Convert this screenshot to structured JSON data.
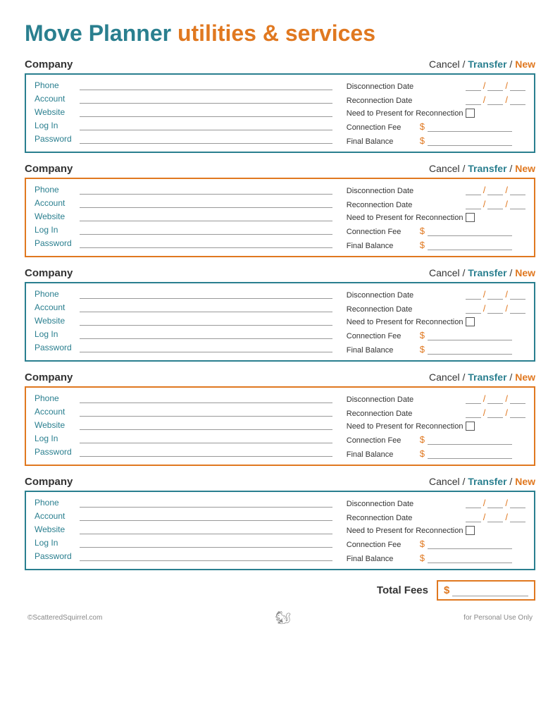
{
  "page": {
    "title_blue": "Move Planner",
    "title_orange": "utilities & services"
  },
  "sections": [
    {
      "id": 1,
      "border": "teal",
      "company_label": "Company",
      "cancel_label": "Cancel",
      "slash1": "/",
      "transfer_label": "Transfer",
      "slash2": "/",
      "new_label": "New",
      "left_fields": [
        {
          "label": "Phone"
        },
        {
          "label": "Account"
        },
        {
          "label": "Website"
        },
        {
          "label": "Log In"
        },
        {
          "label": "Password"
        }
      ],
      "right_fields": [
        {
          "type": "date",
          "label": "Disconnection Date"
        },
        {
          "type": "date",
          "label": "Reconnection Date"
        },
        {
          "type": "checkbox",
          "label": "Need to Present for Reconnection"
        },
        {
          "type": "fee",
          "label": "Connection Fee"
        },
        {
          "type": "fee",
          "label": "Final Balance"
        }
      ]
    },
    {
      "id": 2,
      "border": "orange",
      "company_label": "Company",
      "cancel_label": "Cancel",
      "slash1": "/",
      "transfer_label": "Transfer",
      "slash2": "/",
      "new_label": "New",
      "left_fields": [
        {
          "label": "Phone"
        },
        {
          "label": "Account"
        },
        {
          "label": "Website"
        },
        {
          "label": "Log In"
        },
        {
          "label": "Password"
        }
      ],
      "right_fields": [
        {
          "type": "date",
          "label": "Disconnection Date"
        },
        {
          "type": "date",
          "label": "Reconnection Date"
        },
        {
          "type": "checkbox",
          "label": "Need to Present for Reconnection"
        },
        {
          "type": "fee",
          "label": "Connection Fee"
        },
        {
          "type": "fee",
          "label": "Final Balance"
        }
      ]
    },
    {
      "id": 3,
      "border": "teal",
      "company_label": "Company",
      "cancel_label": "Cancel",
      "slash1": "/",
      "transfer_label": "Transfer",
      "slash2": "/",
      "new_label": "New",
      "left_fields": [
        {
          "label": "Phone"
        },
        {
          "label": "Account"
        },
        {
          "label": "Website"
        },
        {
          "label": "Log In"
        },
        {
          "label": "Password"
        }
      ],
      "right_fields": [
        {
          "type": "date",
          "label": "Disconnection Date"
        },
        {
          "type": "date",
          "label": "Reconnection Date"
        },
        {
          "type": "checkbox",
          "label": "Need to Present for Reconnection"
        },
        {
          "type": "fee",
          "label": "Connection Fee"
        },
        {
          "type": "fee",
          "label": "Final Balance"
        }
      ]
    },
    {
      "id": 4,
      "border": "orange",
      "company_label": "Company",
      "cancel_label": "Cancel",
      "slash1": "/",
      "transfer_label": "Transfer",
      "slash2": "/",
      "new_label": "New",
      "left_fields": [
        {
          "label": "Phone"
        },
        {
          "label": "Account"
        },
        {
          "label": "Website"
        },
        {
          "label": "Log In"
        },
        {
          "label": "Password"
        }
      ],
      "right_fields": [
        {
          "type": "date",
          "label": "Disconnection Date"
        },
        {
          "type": "date",
          "label": "Reconnection Date"
        },
        {
          "type": "checkbox",
          "label": "Need to Present for Reconnection"
        },
        {
          "type": "fee",
          "label": "Connection Fee"
        },
        {
          "type": "fee",
          "label": "Final Balance"
        }
      ]
    },
    {
      "id": 5,
      "border": "teal",
      "company_label": "Company",
      "cancel_label": "Cancel",
      "slash1": "/",
      "transfer_label": "Transfer",
      "slash2": "/",
      "new_label": "New",
      "left_fields": [
        {
          "label": "Phone"
        },
        {
          "label": "Account"
        },
        {
          "label": "Website"
        },
        {
          "label": "Log In"
        },
        {
          "label": "Password"
        }
      ],
      "right_fields": [
        {
          "type": "date",
          "label": "Disconnection Date"
        },
        {
          "type": "date",
          "label": "Reconnection Date"
        },
        {
          "type": "checkbox",
          "label": "Need to Present for Reconnection"
        },
        {
          "type": "fee",
          "label": "Connection Fee"
        },
        {
          "type": "fee",
          "label": "Final Balance"
        }
      ]
    }
  ],
  "total": {
    "label": "Total Fees",
    "dollar": "$"
  },
  "footer": {
    "left": "©ScatteredSquirrel.com",
    "right": "for Personal Use Only"
  }
}
